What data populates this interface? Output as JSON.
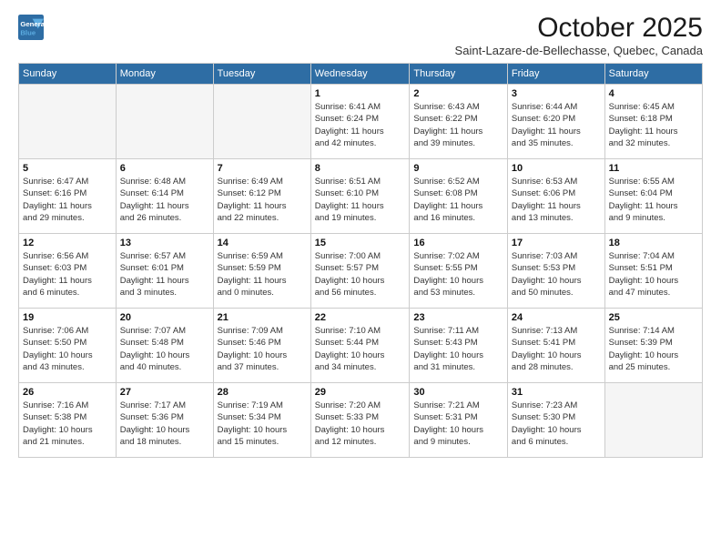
{
  "logo": {
    "line1": "General",
    "line2": "Blue"
  },
  "title": "October 2025",
  "subtitle": "Saint-Lazare-de-Bellechasse, Quebec, Canada",
  "weekdays": [
    "Sunday",
    "Monday",
    "Tuesday",
    "Wednesday",
    "Thursday",
    "Friday",
    "Saturday"
  ],
  "weeks": [
    [
      {
        "day": "",
        "info": ""
      },
      {
        "day": "",
        "info": ""
      },
      {
        "day": "",
        "info": ""
      },
      {
        "day": "1",
        "info": "Sunrise: 6:41 AM\nSunset: 6:24 PM\nDaylight: 11 hours\nand 42 minutes."
      },
      {
        "day": "2",
        "info": "Sunrise: 6:43 AM\nSunset: 6:22 PM\nDaylight: 11 hours\nand 39 minutes."
      },
      {
        "day": "3",
        "info": "Sunrise: 6:44 AM\nSunset: 6:20 PM\nDaylight: 11 hours\nand 35 minutes."
      },
      {
        "day": "4",
        "info": "Sunrise: 6:45 AM\nSunset: 6:18 PM\nDaylight: 11 hours\nand 32 minutes."
      }
    ],
    [
      {
        "day": "5",
        "info": "Sunrise: 6:47 AM\nSunset: 6:16 PM\nDaylight: 11 hours\nand 29 minutes."
      },
      {
        "day": "6",
        "info": "Sunrise: 6:48 AM\nSunset: 6:14 PM\nDaylight: 11 hours\nand 26 minutes."
      },
      {
        "day": "7",
        "info": "Sunrise: 6:49 AM\nSunset: 6:12 PM\nDaylight: 11 hours\nand 22 minutes."
      },
      {
        "day": "8",
        "info": "Sunrise: 6:51 AM\nSunset: 6:10 PM\nDaylight: 11 hours\nand 19 minutes."
      },
      {
        "day": "9",
        "info": "Sunrise: 6:52 AM\nSunset: 6:08 PM\nDaylight: 11 hours\nand 16 minutes."
      },
      {
        "day": "10",
        "info": "Sunrise: 6:53 AM\nSunset: 6:06 PM\nDaylight: 11 hours\nand 13 minutes."
      },
      {
        "day": "11",
        "info": "Sunrise: 6:55 AM\nSunset: 6:04 PM\nDaylight: 11 hours\nand 9 minutes."
      }
    ],
    [
      {
        "day": "12",
        "info": "Sunrise: 6:56 AM\nSunset: 6:03 PM\nDaylight: 11 hours\nand 6 minutes."
      },
      {
        "day": "13",
        "info": "Sunrise: 6:57 AM\nSunset: 6:01 PM\nDaylight: 11 hours\nand 3 minutes."
      },
      {
        "day": "14",
        "info": "Sunrise: 6:59 AM\nSunset: 5:59 PM\nDaylight: 11 hours\nand 0 minutes."
      },
      {
        "day": "15",
        "info": "Sunrise: 7:00 AM\nSunset: 5:57 PM\nDaylight: 10 hours\nand 56 minutes."
      },
      {
        "day": "16",
        "info": "Sunrise: 7:02 AM\nSunset: 5:55 PM\nDaylight: 10 hours\nand 53 minutes."
      },
      {
        "day": "17",
        "info": "Sunrise: 7:03 AM\nSunset: 5:53 PM\nDaylight: 10 hours\nand 50 minutes."
      },
      {
        "day": "18",
        "info": "Sunrise: 7:04 AM\nSunset: 5:51 PM\nDaylight: 10 hours\nand 47 minutes."
      }
    ],
    [
      {
        "day": "19",
        "info": "Sunrise: 7:06 AM\nSunset: 5:50 PM\nDaylight: 10 hours\nand 43 minutes."
      },
      {
        "day": "20",
        "info": "Sunrise: 7:07 AM\nSunset: 5:48 PM\nDaylight: 10 hours\nand 40 minutes."
      },
      {
        "day": "21",
        "info": "Sunrise: 7:09 AM\nSunset: 5:46 PM\nDaylight: 10 hours\nand 37 minutes."
      },
      {
        "day": "22",
        "info": "Sunrise: 7:10 AM\nSunset: 5:44 PM\nDaylight: 10 hours\nand 34 minutes."
      },
      {
        "day": "23",
        "info": "Sunrise: 7:11 AM\nSunset: 5:43 PM\nDaylight: 10 hours\nand 31 minutes."
      },
      {
        "day": "24",
        "info": "Sunrise: 7:13 AM\nSunset: 5:41 PM\nDaylight: 10 hours\nand 28 minutes."
      },
      {
        "day": "25",
        "info": "Sunrise: 7:14 AM\nSunset: 5:39 PM\nDaylight: 10 hours\nand 25 minutes."
      }
    ],
    [
      {
        "day": "26",
        "info": "Sunrise: 7:16 AM\nSunset: 5:38 PM\nDaylight: 10 hours\nand 21 minutes."
      },
      {
        "day": "27",
        "info": "Sunrise: 7:17 AM\nSunset: 5:36 PM\nDaylight: 10 hours\nand 18 minutes."
      },
      {
        "day": "28",
        "info": "Sunrise: 7:19 AM\nSunset: 5:34 PM\nDaylight: 10 hours\nand 15 minutes."
      },
      {
        "day": "29",
        "info": "Sunrise: 7:20 AM\nSunset: 5:33 PM\nDaylight: 10 hours\nand 12 minutes."
      },
      {
        "day": "30",
        "info": "Sunrise: 7:21 AM\nSunset: 5:31 PM\nDaylight: 10 hours\nand 9 minutes."
      },
      {
        "day": "31",
        "info": "Sunrise: 7:23 AM\nSunset: 5:30 PM\nDaylight: 10 hours\nand 6 minutes."
      },
      {
        "day": "",
        "info": ""
      }
    ]
  ]
}
